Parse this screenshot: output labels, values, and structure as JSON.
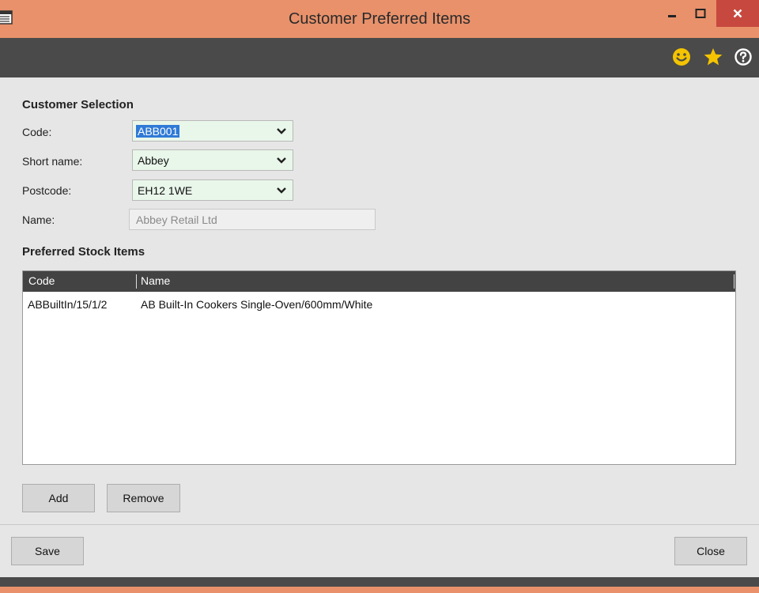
{
  "window": {
    "title": "Customer Preferred Items",
    "icons": [
      "app-icon",
      "minimize-icon",
      "maximize-icon",
      "close-icon"
    ]
  },
  "toolbar": {
    "icons": [
      "smiley-icon",
      "star-icon",
      "help-icon"
    ],
    "colors": {
      "smiley": "#f4c400",
      "star": "#f4c400",
      "help": "#ffffff"
    }
  },
  "customer_selection": {
    "heading": "Customer Selection",
    "code_label": "Code:",
    "code_value": "ABB001",
    "short_name_label": "Short name:",
    "short_name_value": "Abbey",
    "postcode_label": "Postcode:",
    "postcode_value": "EH12 1WE",
    "name_label": "Name:",
    "name_value": "Abbey Retail Ltd"
  },
  "preferred_items": {
    "heading": "Preferred Stock Items",
    "columns": [
      "Code",
      "Name"
    ],
    "rows": [
      {
        "code": "ABBuiltIn/15/1/2",
        "name": "AB Built-In Cookers Single-Oven/600mm/White"
      }
    ],
    "add_label": "Add",
    "remove_label": "Remove"
  },
  "footer": {
    "save_label": "Save",
    "close_label": "Close"
  },
  "colors": {
    "titlebar": "#e8916b",
    "toolbar": "#4a4a4a",
    "close_button": "#c7483e",
    "combo_background": "#e9f6ea",
    "selection": "#2f7ad7",
    "grid_header": "#434343"
  }
}
